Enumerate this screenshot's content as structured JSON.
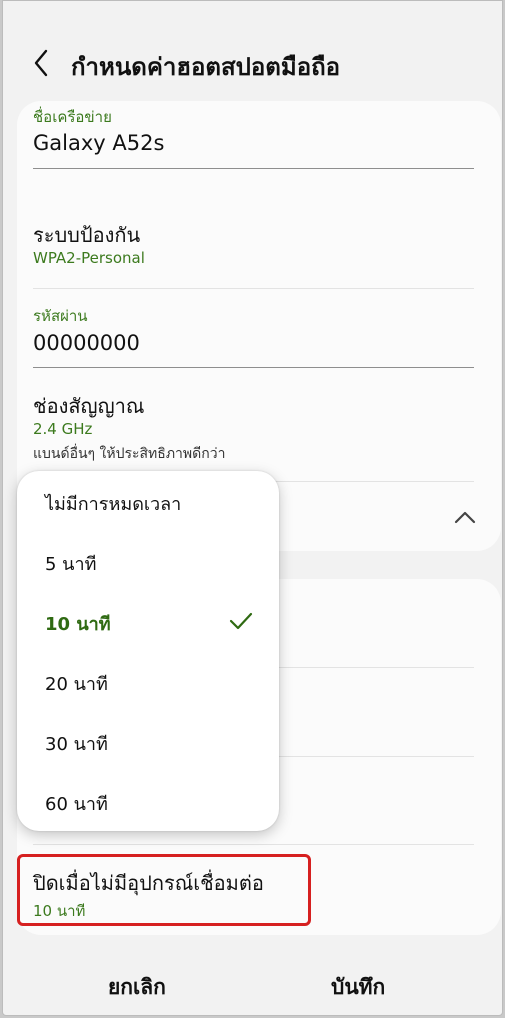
{
  "header": {
    "title": "กำหนดค่าฮอตสปอตมือถือ"
  },
  "network": {
    "label": "ชื่อเครือข่าย",
    "value": "Galaxy A52s"
  },
  "security": {
    "title": "ระบบป้องกัน",
    "value": "WPA2-Personal"
  },
  "password": {
    "label": "รหัสผ่าน",
    "value": "00000000"
  },
  "band": {
    "title": "ช่องสัญญาณ",
    "value": "2.4 GHz",
    "note": "แบนด์อื่นๆ ให้ประสิทธิภาพดีกว่า"
  },
  "timeout_menu": {
    "options": [
      "ไม่มีการหมดเวลา",
      "5 นาที",
      "10 นาที",
      "20 นาที",
      "30 นาที",
      "60 นาที"
    ],
    "selected": "10 นาที"
  },
  "auto_off": {
    "title": "ปิดเมื่อไม่มีอุปกรณ์เชื่อมต่อ",
    "value": "10 นาที"
  },
  "buttons": {
    "cancel": "ยกเลิก",
    "save": "บันทึก"
  },
  "colors": {
    "accent_green": "#3c7a1e",
    "highlight_red": "#d62020"
  }
}
